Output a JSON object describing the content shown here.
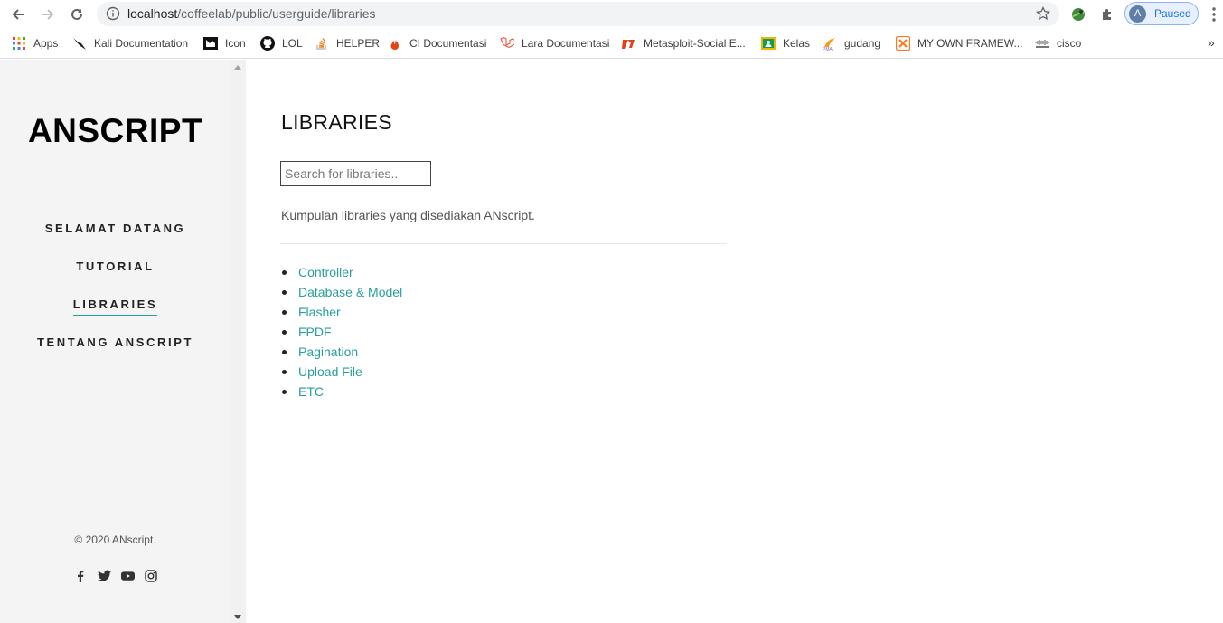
{
  "browser": {
    "url_host": "localhost",
    "url_path": "/coffeelab/public/userguide/libraries",
    "profile_initial": "A",
    "profile_status": "Paused"
  },
  "bookmarks": [
    {
      "label": "Apps",
      "icon": "apps-grid-icon"
    },
    {
      "label": "Kali Documentation",
      "icon": "kali-dragon-icon"
    },
    {
      "label": "Icon",
      "icon": "icon-site-icon"
    },
    {
      "label": "LOL",
      "icon": "github-icon"
    },
    {
      "label": "HELPER",
      "icon": "stackoverflow-icon"
    },
    {
      "label": "CI Documentasi",
      "icon": "codeigniter-icon"
    },
    {
      "label": "Lara Documentasi",
      "icon": "laravel-icon"
    },
    {
      "label": "Metasploit-Social E...",
      "icon": "metasploit-icon"
    },
    {
      "label": "Kelas",
      "icon": "classroom-icon"
    },
    {
      "label": "gudang",
      "icon": "phpmyadmin-icon"
    },
    {
      "label": "MY OWN FRAMEW...",
      "icon": "xampp-icon"
    },
    {
      "label": "cisco",
      "icon": "cisco-icon"
    }
  ],
  "sidebar": {
    "brand": "ANSCRIPT",
    "nav": [
      {
        "label": "SELAMAT DATANG",
        "active": false
      },
      {
        "label": "TUTORIAL",
        "active": false
      },
      {
        "label": "LIBRARIES",
        "active": true
      },
      {
        "label": "TENTANG ANSCRIPT",
        "active": false
      }
    ],
    "copyright": "© 2020 ANscript.",
    "social": [
      "facebook-icon",
      "twitter-icon",
      "youtube-icon",
      "instagram-icon"
    ]
  },
  "main": {
    "title": "LIBRARIES",
    "search_placeholder": "Search for libraries..",
    "intro": "Kumpulan libraries yang disediakan ANscript.",
    "libraries": [
      "Controller",
      "Database & Model",
      "Flasher",
      "FPDF",
      "Pagination",
      "Upload File",
      "ETC"
    ]
  },
  "colors": {
    "accent": "#2a9d9d",
    "sidebar_bg": "#f4f4f4"
  }
}
